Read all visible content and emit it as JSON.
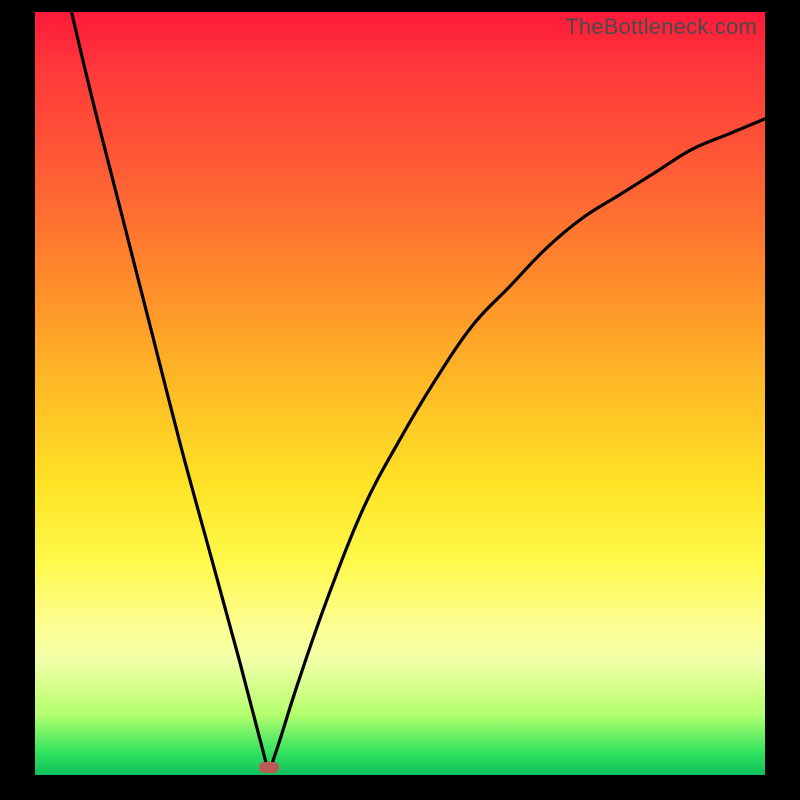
{
  "watermark": "TheBottleneck.com",
  "chart_data": {
    "type": "line",
    "title": "",
    "xlabel": "",
    "ylabel": "",
    "legend": false,
    "grid": false,
    "xlim": [
      0,
      100
    ],
    "ylim": [
      0,
      100
    ],
    "series": [
      {
        "name": "curve",
        "comment": "V-shaped curve: steep descending left branch from top-left to a minimum near x≈32, then rising concave right branch; values estimated from pixel positions (y=0 at bottom, y=100 at top).",
        "x_values": [
          5,
          8,
          12,
          16,
          20,
          24,
          28,
          31,
          32,
          33,
          36,
          40,
          45,
          50,
          55,
          60,
          65,
          70,
          75,
          80,
          85,
          90,
          95,
          100
        ],
        "y_values": [
          100,
          88,
          73,
          58,
          43,
          29,
          15,
          4,
          1,
          3,
          12,
          23,
          35,
          44,
          52,
          59,
          64,
          69,
          73,
          76,
          79,
          82,
          84,
          86
        ]
      }
    ],
    "marker": {
      "comment": "small rounded red-brown indicator at the minimum of the curve",
      "x": 32,
      "y": 1,
      "color": "#bb5b57"
    },
    "background_gradient": {
      "top_color": "#ff1a3a",
      "bottom_color": "#0fbf5c"
    }
  }
}
